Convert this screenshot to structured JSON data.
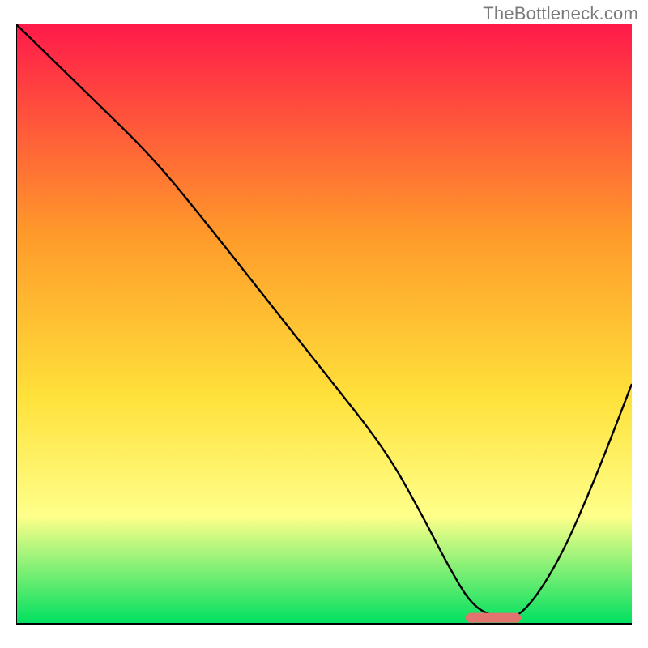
{
  "watermark": "TheBottleneck.com",
  "chart_data": {
    "type": "line",
    "title": "",
    "xlabel": "",
    "ylabel": "",
    "ylim": [
      0,
      100
    ],
    "xlim": [
      0,
      100
    ],
    "grid": false,
    "legend": false,
    "background_gradient": [
      "#ff1a4a",
      "#ff9a2a",
      "#ffe13a",
      "#ffff8a",
      "#00e060"
    ],
    "x": [
      0,
      12,
      22,
      30,
      40,
      50,
      60,
      66,
      70,
      74,
      78,
      82,
      88,
      94,
      100
    ],
    "values": [
      100,
      88,
      78,
      68,
      55,
      42,
      29,
      18,
      10,
      3,
      1,
      1,
      10,
      24,
      40
    ],
    "marker": {
      "x_start": 73,
      "x_end": 82,
      "y": 1,
      "color": "#e3736f"
    },
    "axis_color": "#000000",
    "line_color": "#000000",
    "line_width": 2
  }
}
